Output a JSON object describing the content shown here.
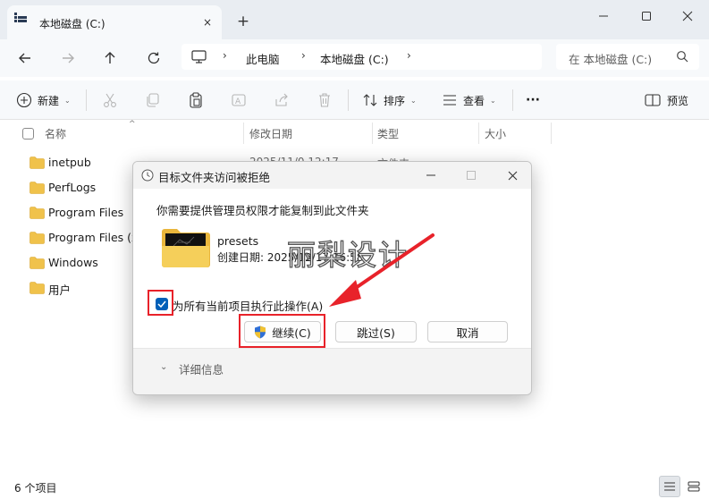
{
  "window": {
    "tab_title": "本地磁盘 (C:)",
    "tab_close_icon": "×",
    "new_tab_icon": "+"
  },
  "address": {
    "crumbs": [
      "此电脑",
      "本地磁盘 (C:)"
    ],
    "search_placeholder": "在 本地磁盘 (C:)"
  },
  "toolbar": {
    "new_label": "新建",
    "sort_label": "排序",
    "view_label": "查看",
    "more_label": "···",
    "preview_label": "预览"
  },
  "list": {
    "columns": [
      "名称",
      "修改日期",
      "类型",
      "大小"
    ],
    "partial_date": "2025/11/0 12:17",
    "partial_type": "文件夹",
    "items": [
      "inetpub",
      "PerfLogs",
      "Program Files",
      "Program Files (x86)",
      "Windows",
      "用户"
    ]
  },
  "status": {
    "item_count": "6 个项目"
  },
  "dialog": {
    "title": "目标文件夹访问被拒绝",
    "message": "你需要提供管理员权限才能复制到此文件夹",
    "file_name": "presets",
    "file_created": "创建日期: 2025/12/17 16:58",
    "watermark": "丽梨设计",
    "apply_all_label": "为所有当前项目执行此操作(A)",
    "apply_all_checked": true,
    "continue_label": "继续(C)",
    "skip_label": "跳过(S)",
    "cancel_label": "取消",
    "details_label": "详细信息"
  },
  "colors": {
    "accent": "#005fb8",
    "highlight": "#e8222a",
    "folder": "#f0c24b"
  }
}
